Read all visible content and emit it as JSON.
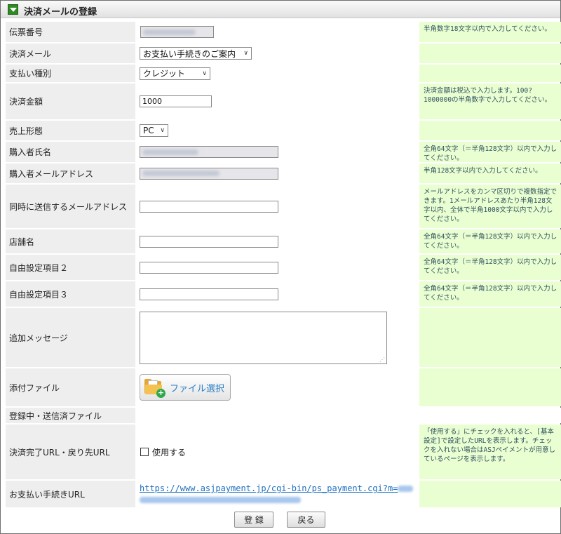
{
  "window": {
    "title": "決済メールの登録"
  },
  "form": {
    "slip_number": {
      "label": "伝票番号",
      "note": "半角数字18文字以内で入力してください。"
    },
    "payment_mail": {
      "label": "決済メール",
      "selected": "お支払い手続きのご案内"
    },
    "payment_type": {
      "label": "支払い種別",
      "selected": "クレジット"
    },
    "amount": {
      "label": "決済金額",
      "value": "1000",
      "note": "決済金額は税込で入力します。100?1000000の半角数字で入力してください。"
    },
    "sales_form": {
      "label": "売上形態",
      "selected": "PC"
    },
    "buyer_name": {
      "label": "購入者氏名",
      "note": "全角64文字（＝半角128文字）以内で入力してください。"
    },
    "buyer_email": {
      "label": "購入者メールアドレス",
      "note": "半角128文字以内で入力してください。"
    },
    "cc_email": {
      "label": "同時に送信するメールアドレス",
      "note": "メールアドレスをカンマ区切りで複数指定できます。1メールアドレスあたり半角128文字以内、全体で半角1000文字以内で入力してください。"
    },
    "shop_name": {
      "label": "店舗名",
      "note": "全角64文字（＝半角128文字）以内で入力してください。"
    },
    "free_field_2": {
      "label": "自由設定項目２",
      "note": "全角64文字（＝半角128文字）以内で入力してください。"
    },
    "free_field_3": {
      "label": "自由設定項目３",
      "note": "全角64文字（＝半角128文字）以内で入力してください。"
    },
    "message": {
      "label": "追加メッセージ"
    },
    "attachment": {
      "label": "添付ファイル",
      "button_label": "ファイル選択"
    },
    "registered_files": {
      "label": "登録中・送信済ファイル"
    },
    "return_url": {
      "label": "決済完了URL・戻り先URL",
      "checkbox_label": "使用する",
      "note": "「使用する」にチェックを入れると、[基本設定]で設定したURLを表示します。チェックを入れない場合はASJペイメントが用意しているページを表示します。"
    },
    "payment_url": {
      "label": "お支払い手続きURL",
      "link_text": "https://www.asjpayment.jp/cgi-bin/ps_payment.cgi?m="
    }
  },
  "actions": {
    "register": "登 録",
    "back": "戻る"
  },
  "icons": {
    "header": "triangle-down-icon",
    "attach": "folder-add-icon"
  },
  "colors": {
    "note_bg": "#eaffd1",
    "label_bg": "#eeeeee",
    "link": "#1d6fc0"
  }
}
